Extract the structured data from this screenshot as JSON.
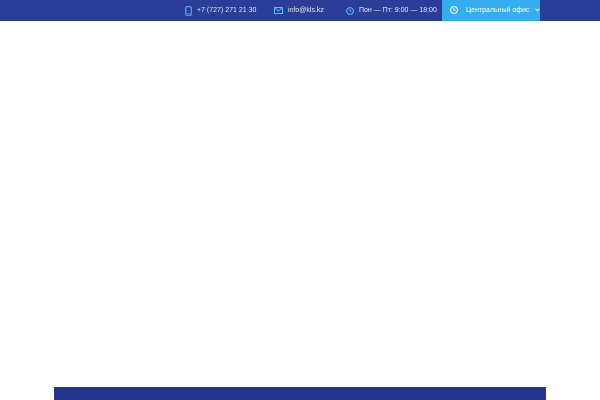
{
  "topbar": {
    "background": "#2b3d96",
    "phone": {
      "icon": "phone-icon",
      "text": "+7 (727) 271 21 30"
    },
    "email": {
      "icon": "mail-icon",
      "text": "info@kls.kz"
    },
    "hours": {
      "icon": "clock-icon",
      "text": "Пон — Пт: 9:00 — 18:00"
    },
    "office_select": {
      "icon": "clock-icon",
      "selected": "Центральный офис",
      "background": "#35aef0",
      "chevron": "chevron-down-icon"
    }
  },
  "footer_band": {
    "background": "#25348c"
  }
}
